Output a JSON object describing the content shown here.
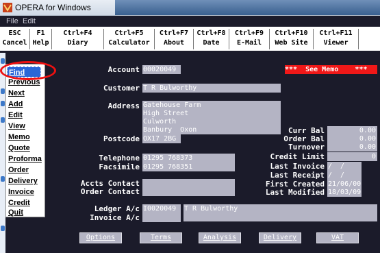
{
  "window": {
    "title": "OPERA for Windows"
  },
  "menubar": {
    "file": "File",
    "edit": "Edit"
  },
  "fkeys": [
    {
      "key": "ESC",
      "label": "Cancel"
    },
    {
      "key": "F1",
      "label": "Help"
    },
    {
      "key": "Ctrl+F4",
      "label": "Diary"
    },
    {
      "key": "Ctrl+F5",
      "label": "Calculator"
    },
    {
      "key": "Ctrl+F7",
      "label": "About"
    },
    {
      "key": "Ctrl+F8",
      "label": "Date"
    },
    {
      "key": "Ctrl+F9",
      "label": "E-Mail"
    },
    {
      "key": "Ctrl+F10",
      "label": "Web Site"
    },
    {
      "key": "Ctrl+F11",
      "label": "Viewer"
    }
  ],
  "menu": [
    {
      "label": "Find",
      "selected": true
    },
    {
      "label": "Previous"
    },
    {
      "label": "Next"
    },
    {
      "label": "Add"
    },
    {
      "label": "Edit"
    },
    {
      "label": "View"
    },
    {
      "label": "Memo"
    },
    {
      "label": "Quote"
    },
    {
      "label": "Proforma"
    },
    {
      "label": "Order"
    },
    {
      "label": "Delivery"
    },
    {
      "label": "Invoice"
    },
    {
      "label": "Credit"
    },
    {
      "label": "Quit"
    }
  ],
  "form": {
    "account_label": "Account",
    "account_value": "00020049",
    "memo_flag": "***  See Memo    ***",
    "customer_label": "Customer",
    "customer_value": "T R Bulworthy",
    "address_label": "Address",
    "address_lines": [
      "Gatehouse Farm",
      "High Street",
      "Culworth",
      "Banbury  Oxon"
    ],
    "postcode_label": "Postcode",
    "postcode_value": "OX17 2BG",
    "telephone_label": "Telephone",
    "telephone_value": "01295 768373",
    "facsimile_label": "Facsimile",
    "facsimile_value": "01295 768351",
    "accts_contact_label": "Accts Contact",
    "order_contact_label": "Order Contact",
    "curr_bal_label": "Curr Bal",
    "curr_bal_value": "0.00",
    "order_bal_label": "Order Bal",
    "order_bal_value": "0.00",
    "turnover_label": "Turnover",
    "turnover_value": "0.00",
    "credit_limit_label": "Credit Limit",
    "credit_limit_value": "0",
    "last_invoice_label": "Last Invoice",
    "last_invoice_value": "/  /",
    "last_receipt_label": "Last Receipt",
    "last_receipt_value": "/  /",
    "first_created_label": "First Created",
    "first_created_value": "21/06/00",
    "last_modified_label": "Last Modified",
    "last_modified_value": "18/03/09",
    "ledger_label": "Ledger A/c",
    "ledger_code": "I0020049",
    "ledger_name": "T R Bulworthy",
    "invoice_label": "Invoice A/c"
  },
  "buttons": [
    "Options",
    "Terms",
    "Analysis",
    "Delivery",
    "VAT"
  ]
}
